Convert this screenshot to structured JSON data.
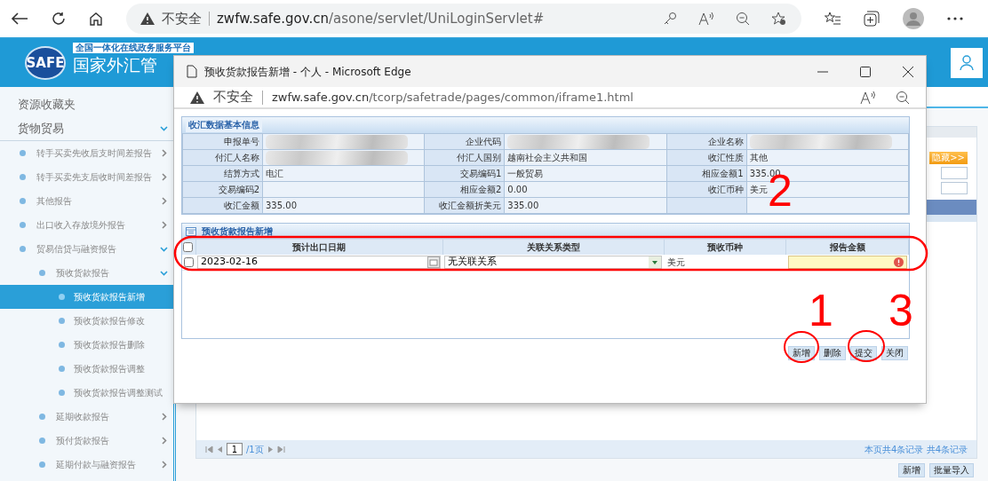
{
  "browser": {
    "security_label": "不安全",
    "url_host": "zwfw.safe.gov.cn",
    "url_path": "/asone/servlet/UniLoginServlet#"
  },
  "site_header": {
    "logo_text": "SAFE",
    "platform_label": "全国一体化在线政务服务平台",
    "title": "国家外汇管"
  },
  "sidebar": {
    "items": [
      {
        "label": "资源收藏夹",
        "selected": false
      },
      {
        "label": "货物贸易",
        "selected": false,
        "expanded": true,
        "children": [
          {
            "label": "转手买卖先收后支时间差报告",
            "selected": false,
            "expanded": false
          },
          {
            "label": "转手买卖先支后收时间差报告",
            "selected": false,
            "expanded": false
          },
          {
            "label": "其他报告",
            "selected": false,
            "expanded": false
          },
          {
            "label": "出口收入存放境外报告",
            "selected": false,
            "expanded": false
          },
          {
            "label": "贸易信贷与融资报告",
            "selected": false,
            "expanded": true,
            "children": [
              {
                "label": "预收货款报告",
                "selected": false,
                "expanded": true,
                "children": [
                  {
                    "label": "预收货款报告新增",
                    "selected": true
                  },
                  {
                    "label": "预收货款报告修改",
                    "selected": false
                  },
                  {
                    "label": "预收货款报告删除",
                    "selected": false
                  },
                  {
                    "label": "预收货款报告调整",
                    "selected": false
                  },
                  {
                    "label": "预收货款报告调整测试",
                    "selected": false
                  }
                ]
              },
              {
                "label": "延期收款报告",
                "selected": false,
                "expanded": false
              },
              {
                "label": "预付货款报告",
                "selected": false,
                "expanded": false
              },
              {
                "label": "延期付款与融资报告",
                "selected": false,
                "expanded": false
              }
            ]
          }
        ]
      }
    ]
  },
  "background_page": {
    "hide_button": "隐藏>>",
    "pager": {
      "page": "1",
      "total": "/1页"
    },
    "record_summary": "本页共4条记录 共4条记录",
    "buttons": [
      "新增",
      "批量导入"
    ]
  },
  "popup": {
    "title": "预收货款报告新增 - 个人 - Microsoft Edge",
    "security_label": "不安全",
    "url_host": "zwfw.safe.gov.cn",
    "url_path": "/tcorp/safetrade/pages/common/iframe1.html",
    "info_panel": {
      "title": "收汇数据基本信息",
      "rows": [
        [
          {
            "label": "申报单号",
            "redacted": true
          },
          {
            "label": "企业代码",
            "redacted": true
          },
          {
            "label": "企业名称",
            "redacted": true
          }
        ],
        [
          {
            "label": "付汇人名称",
            "redacted": true
          },
          {
            "label": "付汇人国别",
            "redacted": false,
            "value": "越南社会主义共和国"
          },
          {
            "label": "收汇性质",
            "redacted": false,
            "value": "其他"
          }
        ],
        [
          {
            "label": "结算方式",
            "redacted": false,
            "value": "电汇"
          },
          {
            "label": "交易编码1",
            "redacted": false,
            "value": "一般贸易"
          },
          {
            "label": "相应金额1",
            "redacted": false,
            "value": "335.00"
          }
        ],
        [
          {
            "label": "交易编码2",
            "redacted": false
          },
          {
            "label": "相应金额2",
            "redacted": false,
            "value": "0.00"
          },
          {
            "label": "收汇币种",
            "redacted": false,
            "value": "美元"
          }
        ],
        [
          {
            "label": "收汇金额",
            "redacted": false,
            "value": "335.00"
          },
          {
            "label": "收汇金额折美元",
            "redacted": false,
            "value": "335.00"
          },
          {
            "redacted": false
          }
        ]
      ]
    },
    "grid": {
      "title": "预收货款报告新增",
      "all_checked": false,
      "columns": [
        "预计出口日期",
        "关联关系类型",
        "预收币种",
        "报告金额"
      ],
      "rows": [
        {
          "checked": false,
          "date": "2023-02-16",
          "relation": "无关联关系",
          "currency": "美元",
          "amount_invalid": true
        }
      ]
    },
    "buttons": [
      "新增",
      "删除",
      "提交",
      "关闭"
    ]
  },
  "annotations": [
    {
      "label": "1"
    },
    {
      "label": "2"
    },
    {
      "label": "3"
    }
  ]
}
